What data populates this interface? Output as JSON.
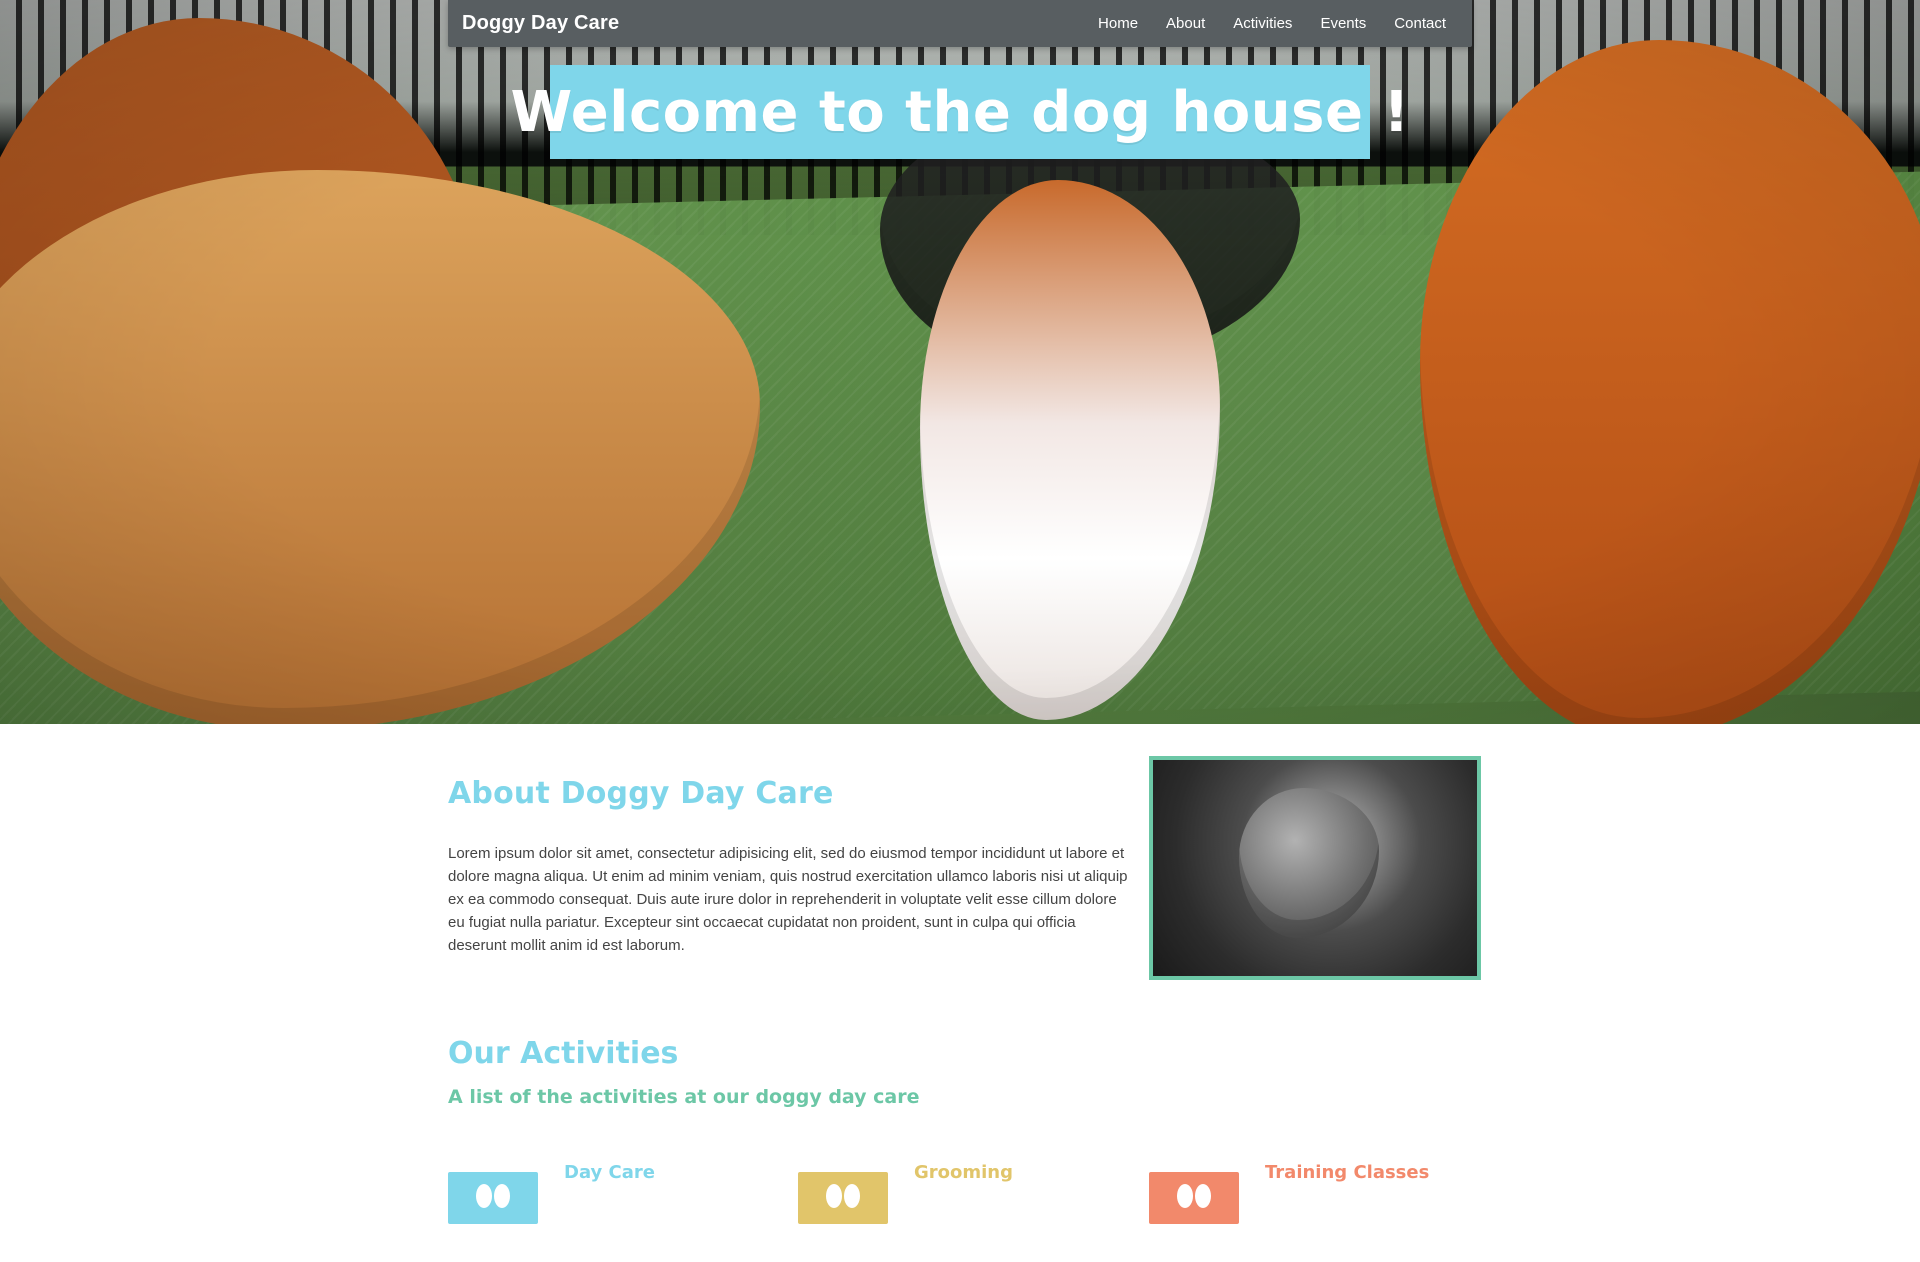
{
  "colors": {
    "nav_bg": "#585e61",
    "accent_blue": "#7fd6ea",
    "accent_green": "#6cc7a6",
    "accent_yellow": "#e1c56a",
    "accent_orange": "#f2896b"
  },
  "header": {
    "brand": "Doggy Day Care",
    "nav": [
      "Home",
      "About",
      "Activities",
      "Events",
      "Contact"
    ]
  },
  "hero": {
    "title": "Welcome to the dog house !"
  },
  "about": {
    "title": "About Doggy Day Care",
    "text": "Lorem ipsum dolor sit amet, consectetur adipisicing elit, sed do eiusmod tempor incididunt ut labore et dolore magna aliqua. Ut enim ad minim veniam, quis nostrud exercitation ullamco laboris nisi ut aliquip ex ea commodo consequat. Duis aute irure dolor in reprehenderit in voluptate velit esse cillum dolore eu fugiat nulla pariatur. Excepteur sint occaecat cupidatat non proident, sunt in culpa qui officia deserunt mollit anim id est laborum."
  },
  "activities": {
    "title": "Our Activities",
    "subtitle": "A list of the activities at our doggy day care",
    "items": [
      {
        "label": "Day Care",
        "color": "#7fd6ea",
        "icon": "paw-icon"
      },
      {
        "label": "Grooming",
        "color": "#e1c56a",
        "icon": "paw-icon"
      },
      {
        "label": "Training Classes",
        "color": "#f2896b",
        "icon": "paw-icon"
      }
    ]
  }
}
